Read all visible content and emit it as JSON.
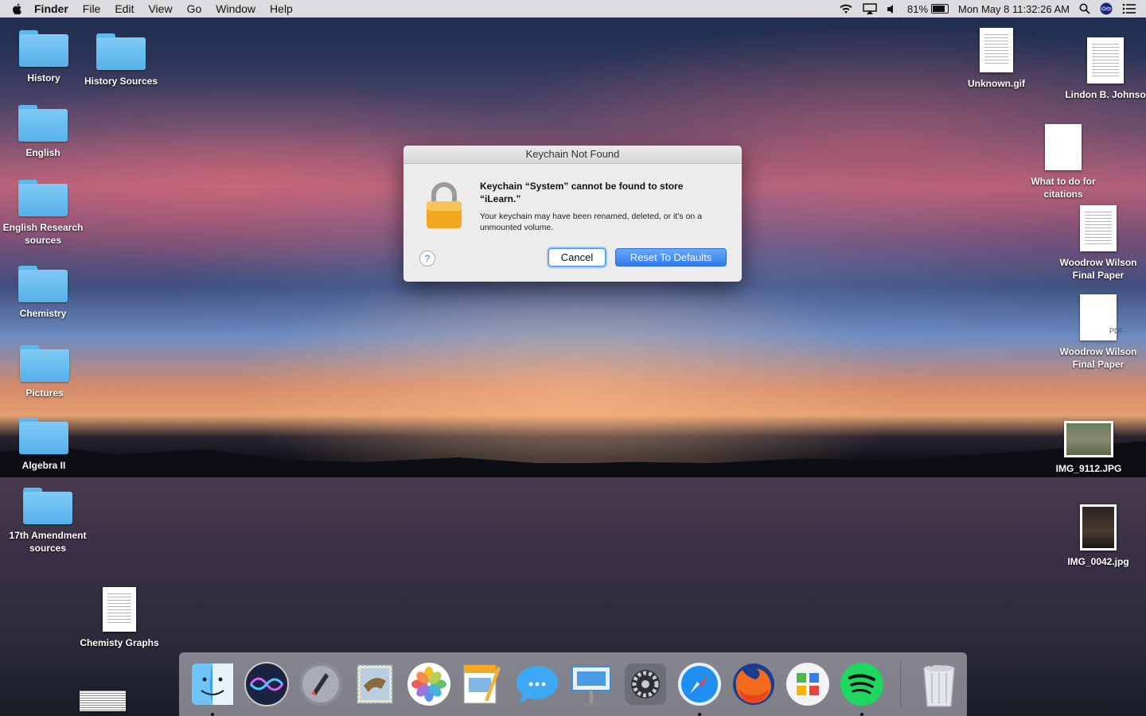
{
  "menubar": {
    "app_name": "Finder",
    "menus": [
      "File",
      "Edit",
      "View",
      "Go",
      "Window",
      "Help"
    ],
    "battery_percent": "81%",
    "battery_level": 0.81,
    "clock": "Mon May 8  11:32:26 AM",
    "icons": [
      "wifi-icon",
      "airplay-icon",
      "volume-icon",
      "battery-icon",
      "spotlight-search-icon",
      "siri-icon",
      "notification-center-icon"
    ]
  },
  "desktop_left": [
    {
      "label": "History",
      "type": "folder"
    },
    {
      "label": "History Sources",
      "type": "folder"
    },
    {
      "label": "English",
      "type": "folder"
    },
    {
      "label": "English Research sources",
      "type": "folder"
    },
    {
      "label": "Chemistry",
      "type": "folder"
    },
    {
      "label": "Pictures",
      "type": "folder"
    },
    {
      "label": "Algebra II",
      "type": "folder"
    },
    {
      "label": "17th Amendment sources",
      "type": "folder"
    },
    {
      "label": "Chemisty Graphs",
      "type": "document"
    }
  ],
  "desktop_right": [
    {
      "label": "Unknown.gif",
      "type": "image"
    },
    {
      "label": "Lindon B. Johnso",
      "type": "document"
    },
    {
      "label": "What to do for citations",
      "type": "document"
    },
    {
      "label": "Woodrow Wilson Final Paper",
      "type": "document"
    },
    {
      "label": "Woodrow Wilson Final Paper",
      "type": "pdf",
      "badge": "PDF"
    },
    {
      "label": "IMG_9112.JPG",
      "type": "photo"
    },
    {
      "label": "IMG_0042.jpg",
      "type": "photo"
    }
  ],
  "dialog": {
    "title": "Keychain Not Found",
    "heading": "Keychain “System” cannot be found to store “iLearn.”",
    "message": "Your keychain may have been renamed, deleted, or it’s on a unmounted volume.",
    "help_label": "?",
    "cancel_label": "Cancel",
    "reset_label": "Reset To Defaults"
  },
  "dock": {
    "apps": [
      "finder-icon",
      "siri-icon",
      "launchpad-icon",
      "mail-icon",
      "photos-icon",
      "pages-icon",
      "messages-icon",
      "keynote-icon",
      "system-preferences-icon",
      "safari-icon",
      "firefox-icon",
      "self-service-icon",
      "spotify-icon"
    ],
    "trash": "trash-icon"
  },
  "colors": {
    "folder": "#5fb7ef",
    "accent": "#2f7bf0"
  }
}
